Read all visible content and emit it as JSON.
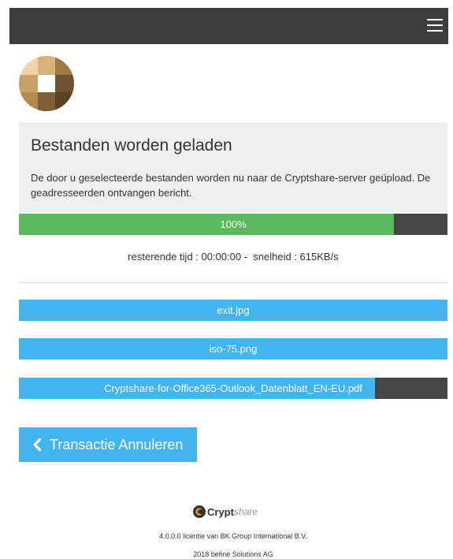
{
  "header": {
    "menu_icon": "hamburger-menu-icon"
  },
  "logo": {
    "icon": "cryptshare-logo-icon"
  },
  "upload": {
    "title": "Bestanden worden geladen",
    "description": "De door u geselecteerde bestanden worden nu naar de Cryptshare-server geüpload. De geadresseerden ontvangen bericht.",
    "progress_label": "100%",
    "progress_fraction": 0.875,
    "remaining_time_text": "resterende tijd : 00:00:00 -  snelheid : 615KB/s"
  },
  "files": [
    {
      "name": "exit.jpg",
      "progress_fraction": 1.0
    },
    {
      "name": "iso-75.png",
      "progress_fraction": 1.0
    },
    {
      "name": "Cryptshare-for-Office365-Outlook_Datenblatt_EN-EU.pdf",
      "progress_fraction": 0.83
    }
  ],
  "actions": {
    "cancel_label": "Transactie Annuleren",
    "cancel_icon": "chevron-left-icon"
  },
  "footer": {
    "brand_strong": "Crypt",
    "brand_light": "share",
    "license": "4.0.0.0 licentie van BK Group International B.V.",
    "copyright": "2018 befine Solutions AG"
  },
  "colors": {
    "topbar": "#3d3d3d",
    "accent_blue": "#42b4ee",
    "progress_green": "#5cb85c",
    "track_dark": "#454545",
    "panel_gray": "#efefef"
  }
}
